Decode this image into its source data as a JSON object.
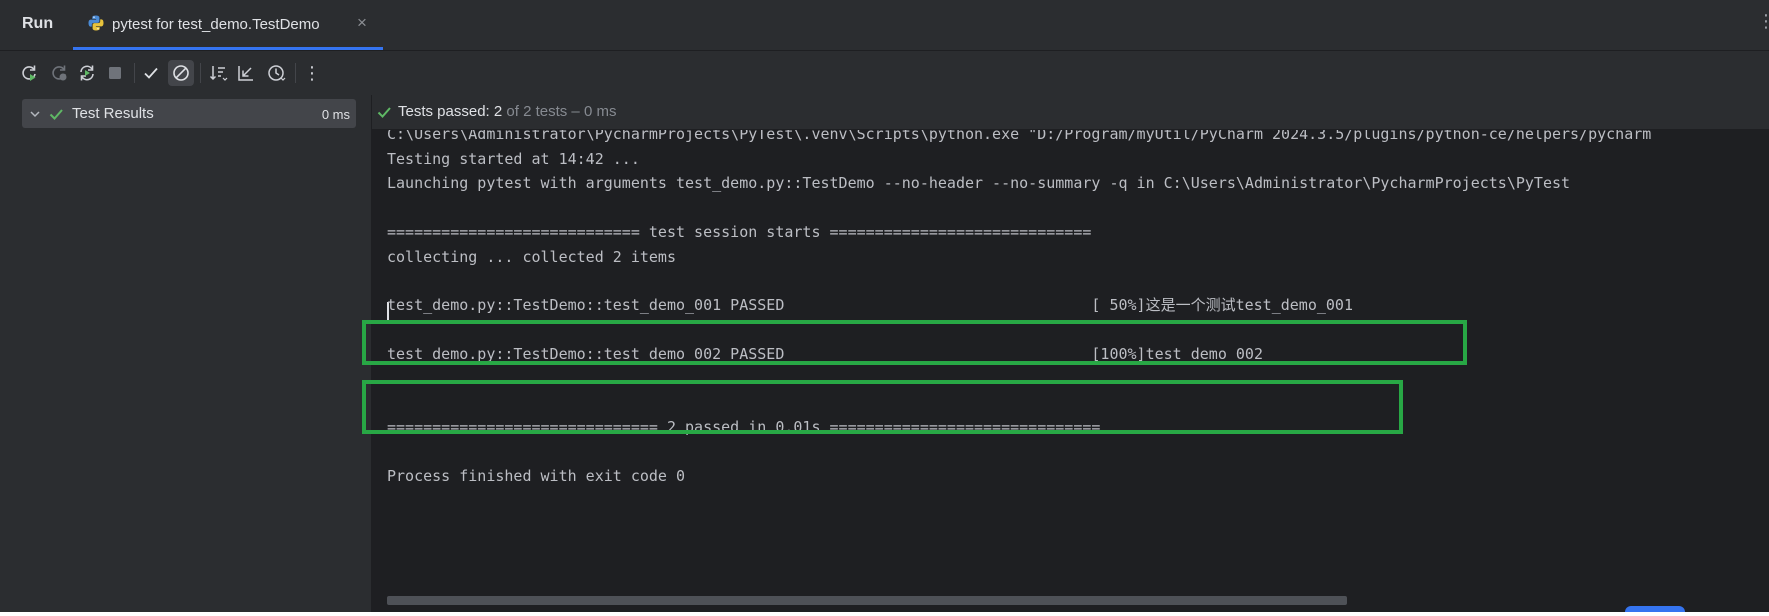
{
  "colors": {
    "accent": "#3574f0",
    "success_green": "#5fb865",
    "highlight_box_green": "#28a745",
    "panel_bg": "#2b2d30",
    "editor_bg": "#1e1f22"
  },
  "header": {
    "run_title": "Run",
    "tab": {
      "icon": "python-icon",
      "label": "pytest for test_demo.TestDemo",
      "close_glyph": "×"
    },
    "more_icon": "more-vertical-icon"
  },
  "toolbar": {
    "buttons": [
      {
        "name": "rerun-button",
        "icon": "rerun-icon"
      },
      {
        "name": "rerun-failed-button",
        "icon": "rerun-failed-icon"
      },
      {
        "name": "toggle-auto-test-button",
        "icon": "auto-rerun-icon"
      },
      {
        "name": "stop-button",
        "icon": "stop-icon"
      },
      {
        "name": "show-passed-button",
        "icon": "check-icon"
      },
      {
        "name": "show-ignored-button",
        "icon": "ignored-icon",
        "active": true
      },
      {
        "name": "sort-alphabetically-button",
        "icon": "sort-icon"
      },
      {
        "name": "import-tests-button",
        "icon": "import-icon"
      },
      {
        "name": "test-history-button",
        "icon": "history-icon"
      },
      {
        "name": "more-options-button",
        "icon": "more-vertical-icon"
      }
    ]
  },
  "results_tree": {
    "root": {
      "label": "Test Results",
      "time": "0 ms",
      "status": "passed",
      "expanded": true
    }
  },
  "status_bar": {
    "passed_text": "Tests passed: 2",
    "total_text": " of 2 tests – 0 ms"
  },
  "console": {
    "lines": [
      "C:\\Users\\Administrator\\PycharmProjects\\PyTest\\.venv\\Scripts\\python.exe \"D:/Program/myUtil/PyCharm 2024.3.5/plugins/python-ce/helpers/pycharm",
      "Testing started at 14:42 ...",
      "Launching pytest with arguments test_demo.py::TestDemo --no-header --no-summary -q in C:\\Users\\Administrator\\PycharmProjects\\PyTest",
      "",
      "============================ test session starts =============================",
      "collecting ... collected 2 items",
      "",
      "test_demo.py::TestDemo::test_demo_001 PASSED                                  [ 50%]这是一个测试test_demo_001",
      "",
      "test_demo.py::TestDemo::test_demo_002 PASSED                                  [100%]test_demo_002",
      "",
      "",
      "============================== 2 passed in 0.01s ==============================",
      "",
      "Process finished with exit code 0"
    ]
  }
}
